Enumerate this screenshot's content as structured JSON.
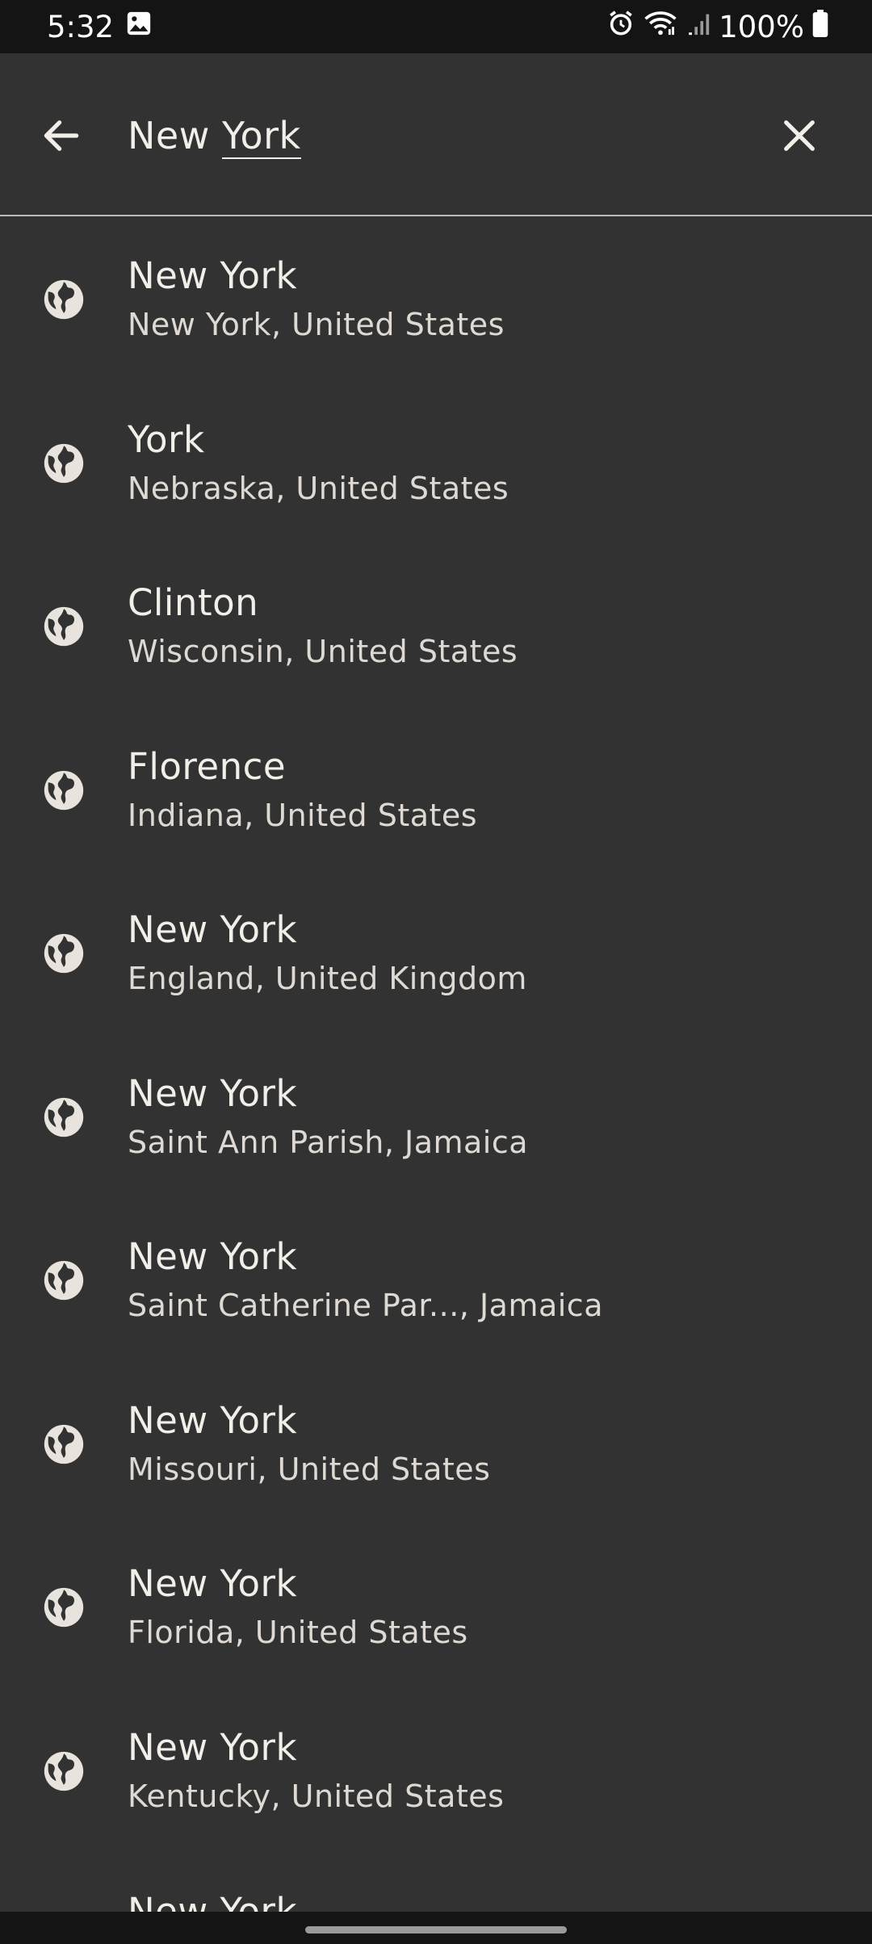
{
  "status_bar": {
    "time": "5:32",
    "battery": "100%",
    "icons": [
      "image-icon",
      "alarm-icon",
      "wifi-icon",
      "signal-icon",
      "battery-icon"
    ]
  },
  "search": {
    "query_prefix": "New ",
    "query_word": "York",
    "back_icon": "arrow-left-icon",
    "clear_icon": "close-icon"
  },
  "results": [
    {
      "city": "New York",
      "region": "New York,  United States"
    },
    {
      "city": "York",
      "region": "Nebraska,  United States"
    },
    {
      "city": "Clinton",
      "region": "Wisconsin,  United States"
    },
    {
      "city": "Florence",
      "region": "Indiana,  United States"
    },
    {
      "city": "New York",
      "region": "England,  United Kingdom"
    },
    {
      "city": "New York",
      "region": "Saint Ann Parish,  Jamaica"
    },
    {
      "city": "New York",
      "region": "Saint Catherine Par...,  Jamaica"
    },
    {
      "city": "New York",
      "region": "Missouri,  United States"
    },
    {
      "city": "New York",
      "region": "Florida,  United States"
    },
    {
      "city": "New York",
      "region": "Kentucky,  United States"
    }
  ],
  "partial_result": {
    "city": "New York"
  },
  "colors": {
    "background": "#333232",
    "text": "#f2efe9",
    "status_bar": "#141414"
  }
}
